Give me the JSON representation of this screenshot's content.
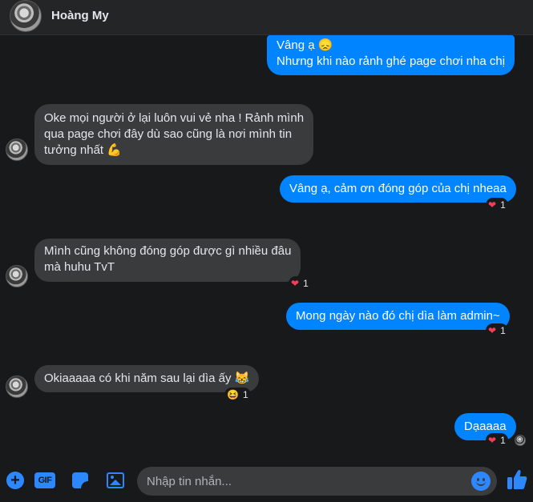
{
  "header": {
    "contact_name": "Hoàng My"
  },
  "messages": [
    {
      "direction": "outgoing",
      "lines": [
        "Vâng ạ 😞",
        "Nhưng khi nào rảnh ghé page chơi nha chị"
      ]
    },
    {
      "direction": "incoming",
      "lines": [
        "Oke mọi người ở lại luôn vui vẻ nha ! Rảnh mình",
        "qua page chơi đây dù sao cũng là nơi mình tin",
        "tưởng nhất 💪"
      ]
    },
    {
      "direction": "outgoing",
      "lines": [
        "Vâng ạ, cảm ơn đóng góp của chị nheaa"
      ],
      "reaction": {
        "emoji": "❤",
        "count": "1"
      }
    },
    {
      "direction": "incoming",
      "lines": [
        "Mình cũng không đóng góp được gì nhiều đâu",
        "mà huhu TvT"
      ],
      "reaction": {
        "emoji": "❤",
        "count": "1"
      }
    },
    {
      "direction": "outgoing",
      "lines": [
        "Mong ngày nào đó chị dìa làm admin~"
      ],
      "reaction": {
        "emoji": "❤",
        "count": "1"
      }
    },
    {
      "direction": "incoming",
      "lines": [
        "Okiaaaaa có khi năm sau lại dìa ấy 😹"
      ],
      "reaction": {
        "emoji": "😆",
        "count": "1"
      }
    },
    {
      "direction": "outgoing",
      "lines": [
        "Dạaaaa"
      ],
      "reaction": {
        "emoji": "❤",
        "count": "1"
      }
    }
  ],
  "composer": {
    "placeholder": "Nhập tin nhắn...",
    "gif_label": "GIF"
  },
  "icons": {
    "add": "plus-circle-icon",
    "gif": "gif-icon",
    "sticker": "sticker-icon",
    "image": "image-icon",
    "emoji": "emoji-icon",
    "like": "thumbs-up-icon"
  },
  "colors": {
    "outgoing_bubble": "#0084ff",
    "incoming_bubble": "#3a3b3c",
    "accent": "#2d88ff",
    "background": "#18191a",
    "heart": "#f33e58"
  }
}
